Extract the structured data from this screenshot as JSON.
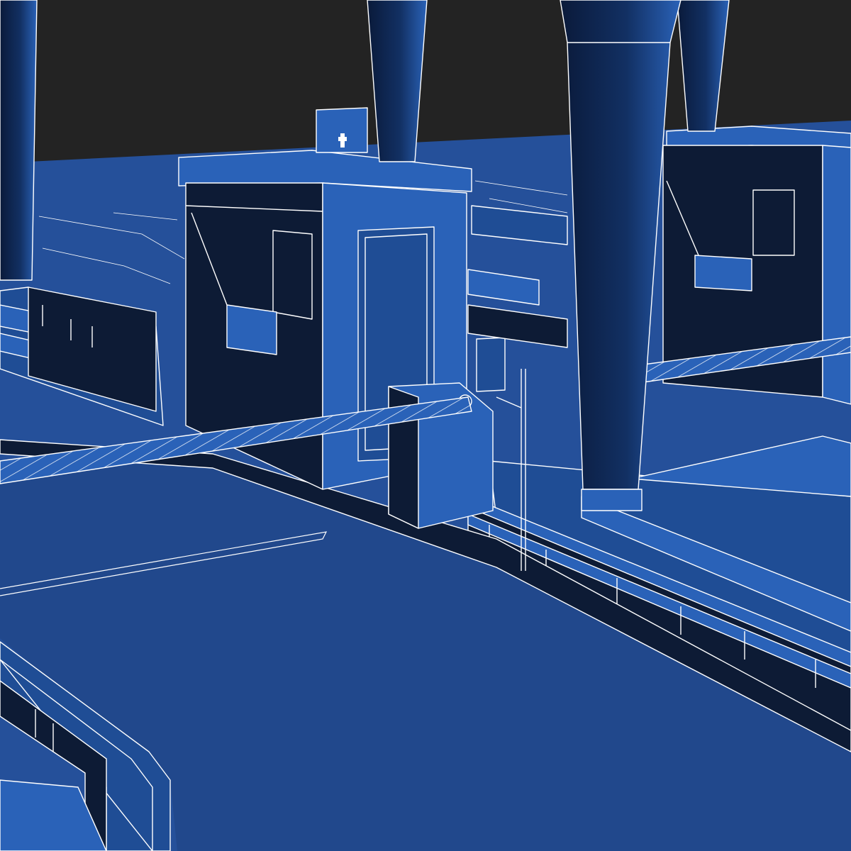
{
  "scene": {
    "kind": "wireframe-render",
    "subject": "toll-plaza",
    "colors": {
      "background": "#232323",
      "ground": "#25509a",
      "road": "#21488c",
      "face_light": "#2a62b8",
      "face_mid": "#1f4d95",
      "face_dark": "#0d1b35",
      "edge": "#ffffff"
    }
  }
}
